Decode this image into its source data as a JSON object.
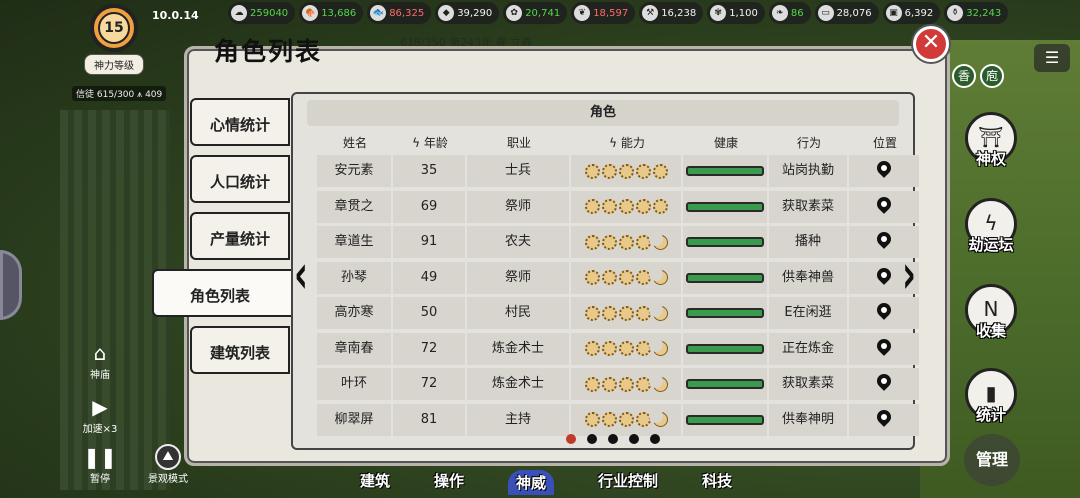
{
  "version": "10.0.14",
  "god": {
    "level": "15",
    "label": "神力等级"
  },
  "believers": {
    "text": "信徒 615/300",
    "extra": "409"
  },
  "resources": [
    {
      "icon": "cloud-icon",
      "value": "259040",
      "tone": "green"
    },
    {
      "icon": "meat-icon",
      "value": "13,686",
      "tone": "green"
    },
    {
      "icon": "fish-icon",
      "value": "86,325",
      "tone": "red"
    },
    {
      "icon": "ore-icon",
      "value": "39,290",
      "tone": "white"
    },
    {
      "icon": "grain-icon",
      "value": "20,741",
      "tone": "green"
    },
    {
      "icon": "herb-icon",
      "value": "18,597",
      "tone": "red"
    },
    {
      "icon": "tool-icon",
      "value": "16,238",
      "tone": "white"
    },
    {
      "icon": "silk-icon",
      "value": "1,100",
      "tone": "white"
    },
    {
      "icon": "feather-icon",
      "value": "86",
      "tone": "green"
    },
    {
      "icon": "bed-icon",
      "value": "28,076",
      "tone": "white"
    },
    {
      "icon": "chest-icon",
      "value": "6,392",
      "tone": "white"
    },
    {
      "icon": "potion-icon",
      "value": "32,243",
      "tone": "green"
    }
  ],
  "status_strip": "618/350   第243年 春 立春",
  "panel": {
    "title": "角色列表",
    "section": "角色",
    "tabs": [
      "心情统计",
      "人口统计",
      "产量统计",
      "角色列表",
      "建筑列表"
    ],
    "active_tab": 3,
    "columns": [
      "姓名",
      "年龄",
      "职业",
      "能力",
      "健康",
      "行为",
      "位置"
    ],
    "rows": [
      {
        "name": "安元素",
        "age": "35",
        "job": "士兵",
        "ability": [
          1,
          1,
          1,
          1,
          1
        ],
        "health": 1.0,
        "action": "站岗执勤"
      },
      {
        "name": "章贯之",
        "age": "69",
        "job": "祭师",
        "ability": [
          1,
          1,
          1,
          1,
          1
        ],
        "health": 1.0,
        "action": "获取素菜"
      },
      {
        "name": "章道生",
        "age": "91",
        "job": "农夫",
        "ability": [
          1,
          1,
          1,
          1,
          0
        ],
        "health": 1.0,
        "action": "播种"
      },
      {
        "name": "孙琴",
        "age": "49",
        "job": "祭师",
        "ability": [
          1,
          1,
          1,
          1,
          0
        ],
        "health": 1.0,
        "action": "供奉神兽"
      },
      {
        "name": "高亦寒",
        "age": "50",
        "job": "村民",
        "ability": [
          1,
          1,
          1,
          1,
          0
        ],
        "health": 1.0,
        "action": "E在闲逛"
      },
      {
        "name": "章南春",
        "age": "72",
        "job": "炼金术士",
        "ability": [
          1,
          1,
          1,
          1,
          0
        ],
        "health": 1.0,
        "action": "正在炼金"
      },
      {
        "name": "叶环",
        "age": "72",
        "job": "炼金术士",
        "ability": [
          1,
          1,
          1,
          1,
          0
        ],
        "health": 1.0,
        "action": "获取素菜"
      },
      {
        "name": "柳翠屏",
        "age": "81",
        "job": "主持",
        "ability": [
          1,
          1,
          1,
          1,
          0
        ],
        "health": 1.0,
        "action": "供奉神明"
      }
    ],
    "page_dots": 5,
    "active_page": 0
  },
  "right_menu": [
    {
      "label": "神权",
      "icon": "temple-icon"
    },
    {
      "label": "劫运坛",
      "icon": "lightning-icon"
    },
    {
      "label": "收集",
      "icon": "collect-icon"
    },
    {
      "label": "统计",
      "icon": "chart-icon"
    }
  ],
  "manage_label": "管理",
  "left_controls": [
    {
      "label": "神庙",
      "icon": "house-icon"
    },
    {
      "label": "加速×3",
      "icon": "play-icon"
    },
    {
      "label": "暂停",
      "icon": "pause-icon"
    }
  ],
  "scenic_label": "景观模式",
  "bottom_nav": [
    "建筑",
    "操作",
    "神威",
    "行业控制",
    "科技"
  ],
  "bottom_nav_active": 2,
  "mini_right": [
    "香",
    "庖"
  ]
}
